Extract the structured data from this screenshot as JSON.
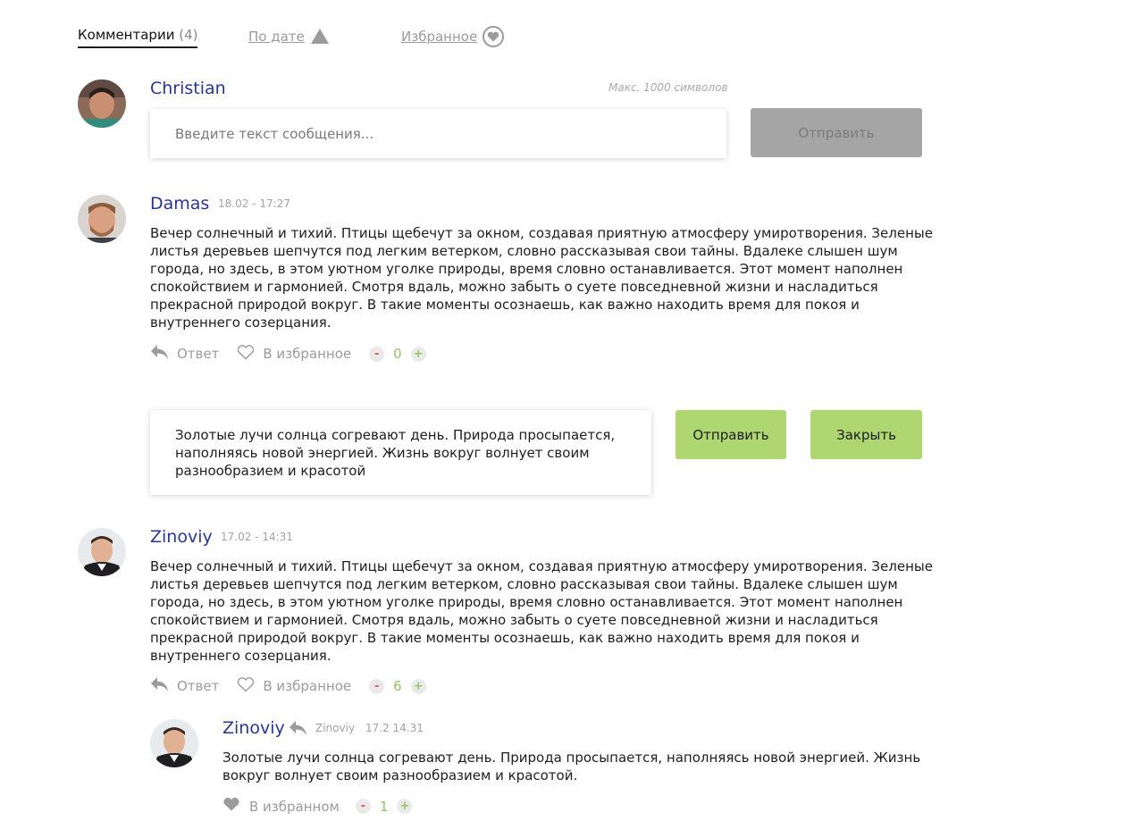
{
  "tabs": {
    "comments_label": "Комментарии",
    "comments_count": "(4)",
    "date_label": "По дате",
    "favorites_label": "Избранное"
  },
  "composer": {
    "username": "Christian",
    "hint": "Макс. 1000 символов",
    "placeholder": "Введите текст сообщения...",
    "send_label": "Отправить"
  },
  "comments": [
    {
      "username": "Damas",
      "date": "18.02 - 17:27",
      "text": "Вечер солнечный и тихий. Птицы щебечут за окном, создавая приятную атмосферу умиротворения. Зеленые листья деревьев шепчутся под легким ветерком, словно рассказывая свои тайны. Вдалеке слышен шум города, но здесь, в этом уютном уголке природы, время словно останавливается. Этот момент наполнен спокойствием и гармонией. Смотря вдаль, можно забыть о суете повседневной жизни и насладиться прекрасной природой вокруг. В такие моменты осознаешь, как важно находить время для покоя и внутреннего созерцания.",
      "reply_label": "Ответ",
      "favorite_label": "В избранное",
      "votes": "0"
    },
    {
      "username": "Zinoviy",
      "date": "17.02 - 14:31",
      "text": "Вечер солнечный и тихий. Птицы щебечут за окном, создавая приятную атмосферу умиротворения. Зеленые листья деревьев шепчутся под легким ветерком, словно рассказывая свои тайны. Вдалеке слышен шум города, но здесь, в этом уютном уголке природы, время словно останавливается. Этот момент наполнен спокойствием и гармонией. Смотря вдаль, можно забыть о суете повседневной жизни и насладиться прекрасной природой вокруг. В такие моменты осознаешь, как важно находить время для покоя и внутреннего созерцания.",
      "reply_label": "Ответ",
      "favorite_label": "В избранное",
      "votes": "6"
    }
  ],
  "reply_form": {
    "text": "Золотые лучи солнца согревают день. Природа просыпается, наполняясь новой энергией. Жизнь вокруг волнует своим разнообразием и красотой",
    "send_label": "Отправить",
    "close_label": "Закрыть"
  },
  "nested_reply": {
    "username": "Zinoviy",
    "reply_to": "Zinoviy",
    "date": "17.2 14.31",
    "text": "Золотые лучи солнца согревают день. Природа просыпается, наполняясь новой энергией. Жизнь вокруг волнует своим разнообразием и красотой.",
    "favorite_label": "В избранном",
    "votes": "1"
  },
  "colors": {
    "username": "#2634a8",
    "accent_green": "#aed772",
    "vote_minus": "#e8555b",
    "vote_plus": "#8fc95e",
    "disabled_button": "#a5a5a5"
  }
}
